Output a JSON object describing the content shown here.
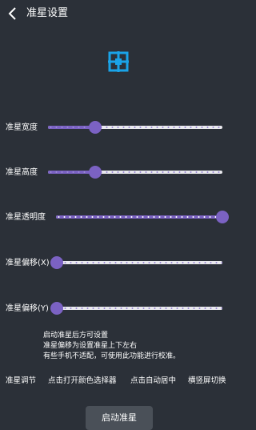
{
  "header": {
    "title": "准星设置"
  },
  "sliders": [
    {
      "label": "准星宽度",
      "value": 0.27
    },
    {
      "label": "准星高度",
      "value": 0.27
    },
    {
      "label": "准星透明度",
      "value": 1.0
    },
    {
      "label": "准星偏移(X)",
      "value": 0.0
    },
    {
      "label": "准星偏移(Y)",
      "value": 0.0
    }
  ],
  "info_lines": [
    "启动准星后方可设置",
    "准星偏移为设置准星上下左右",
    "有些手机不适配，可使用此功能进行校准。"
  ],
  "bottom_labels": {
    "adjust": "准星调节",
    "color_picker": "点击打开颜色选择器",
    "auto_center": "点击自动居中",
    "orientation": "横竖屏切换"
  },
  "start_button": "启动准星",
  "colors": {
    "accent": "#7b62c3",
    "crosshair": "#1aa3e8",
    "background": "#2b3038"
  },
  "icons": {
    "back": "back-arrow-icon",
    "crosshair": "crosshair-icon"
  }
}
